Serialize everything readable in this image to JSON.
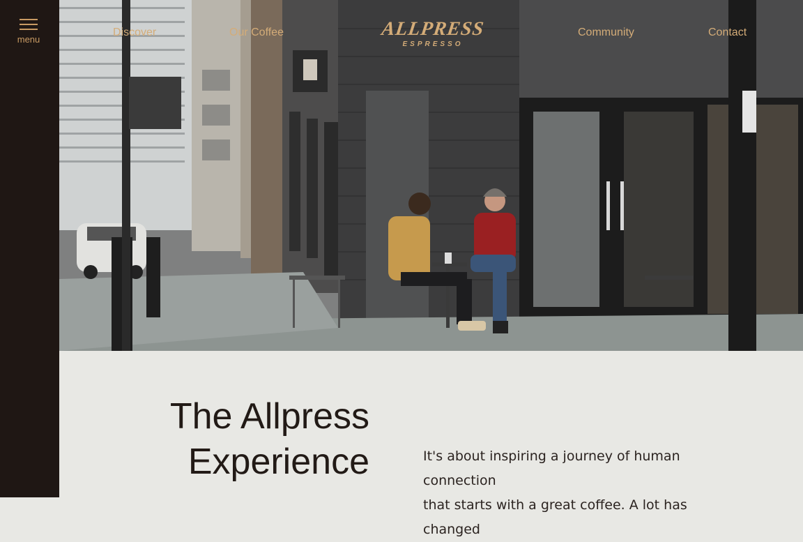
{
  "sidebar": {
    "menu_label": "menu",
    "menu_icon": "hamburger-icon"
  },
  "nav": {
    "links": [
      "Discover",
      "Our Coffee",
      "Community",
      "Contact"
    ]
  },
  "logo": {
    "main": "ALLPRESS",
    "sub": "ESPRESSO"
  },
  "hero": {
    "image_subject": "two-men-talking-at-cafe-storefront"
  },
  "section": {
    "heading_line1": "The Allpress",
    "heading_line2": "Experience",
    "intro_line1": "It's about inspiring a journey of human connection",
    "intro_line2": "that starts with a great coffee. A lot has changed"
  },
  "colors": {
    "sidebar_bg": "#1f1714",
    "accent_gold": "#c89a63",
    "content_bg": "#e8e8e4",
    "heading_text": "#221a16"
  }
}
